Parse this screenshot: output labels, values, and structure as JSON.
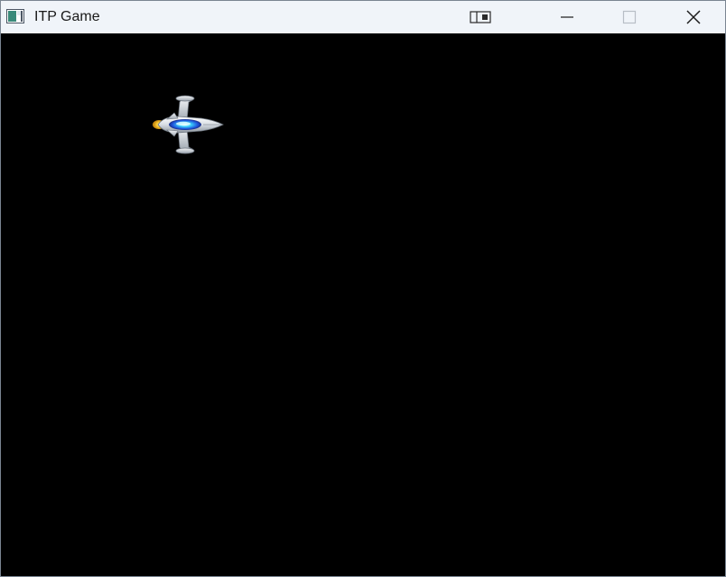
{
  "window": {
    "title": "ITP Game",
    "icon": "app-window-icon",
    "background_color": "#000000"
  },
  "titlebar": {
    "buttons": [
      "snap-layout",
      "minimize",
      "maximize",
      "close"
    ]
  },
  "game": {
    "player_ship": {
      "icon": "spaceship-icon",
      "facing": "right"
    }
  }
}
